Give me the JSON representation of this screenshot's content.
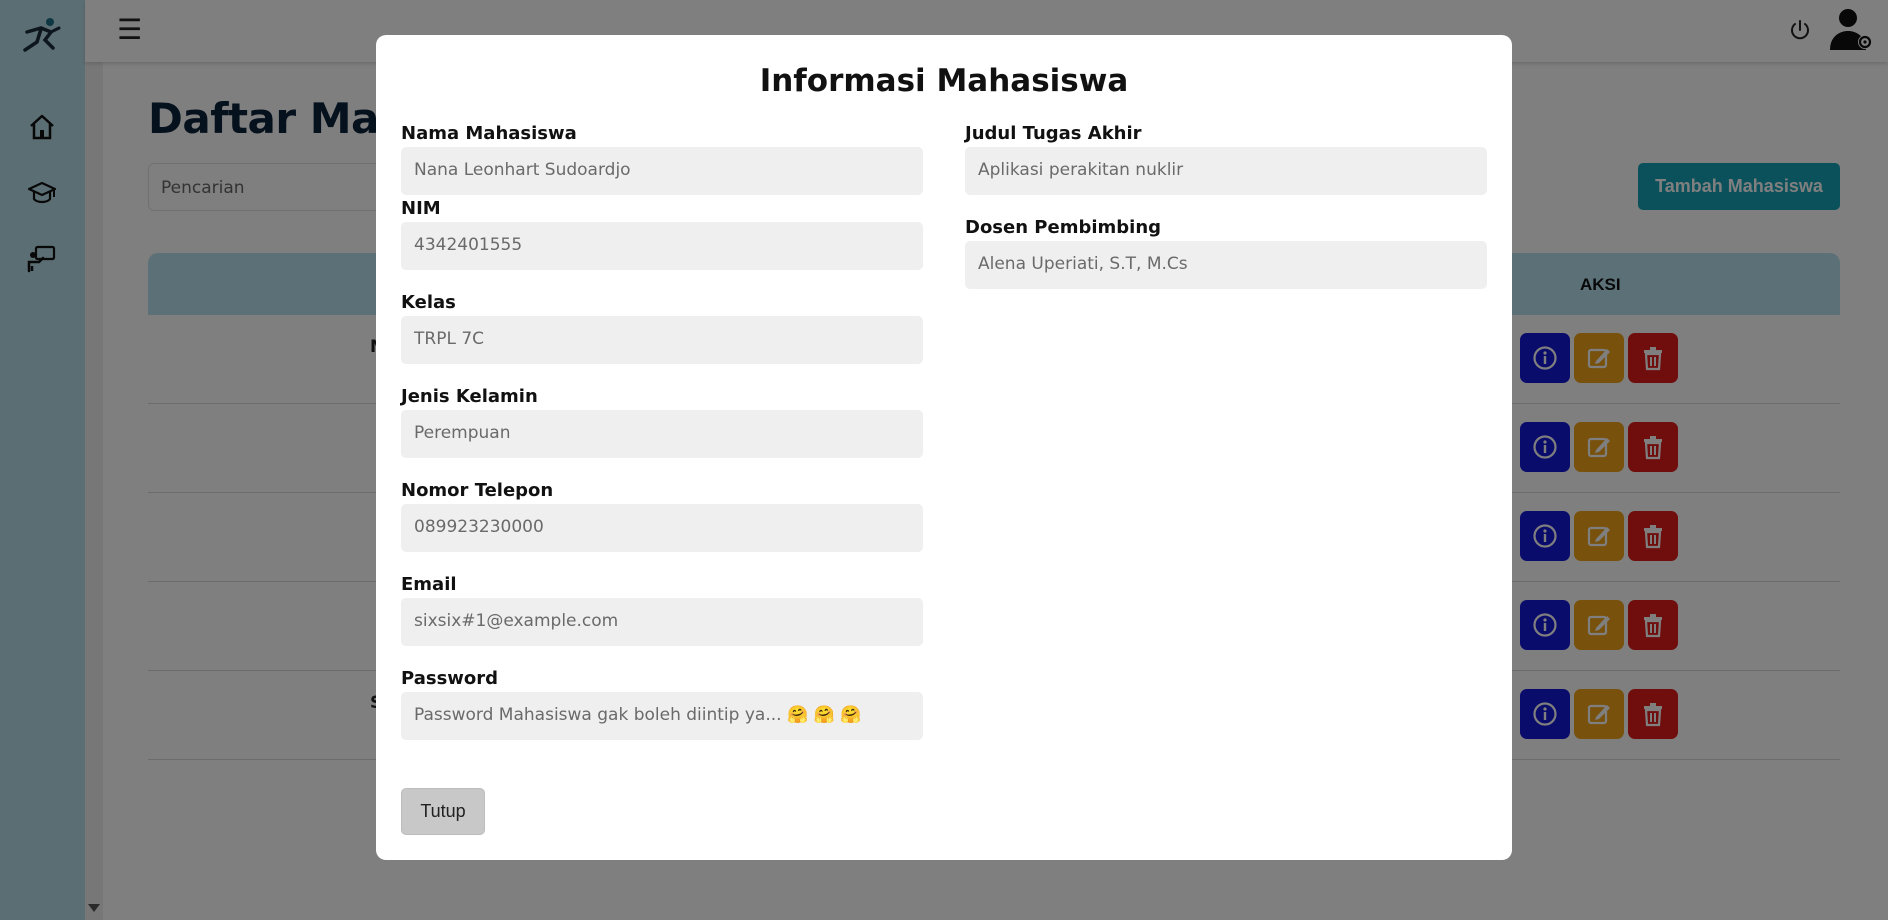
{
  "app": {
    "page_title": "Daftar Maha",
    "search_placeholder": "Pencarian",
    "add_button_label": "Tambah Mahasiswa",
    "table": {
      "action_header": "AKSI",
      "row_fragments": [
        "N",
        "",
        "",
        "",
        "S"
      ]
    }
  },
  "modal": {
    "title": "Informasi Mahasiswa",
    "fields_left": [
      {
        "label": "Nama Mahasiswa",
        "value": "Nana Leonhart Sudoardjo"
      },
      {
        "label": "NIM",
        "value": "4342401555"
      },
      {
        "label": "Kelas",
        "value": "TRPL 7C"
      },
      {
        "label": "Jenis Kelamin",
        "value": "Perempuan"
      },
      {
        "label": "Nomor Telepon",
        "value": "089923230000"
      },
      {
        "label": "Email",
        "value": "sixsix#1@example.com"
      },
      {
        "label": "Password",
        "value": "Password Mahasiswa gak boleh diintip ya... 🤗 🤗 🤗"
      }
    ],
    "fields_right": [
      {
        "label": "Judul Tugas Akhir",
        "value": "Aplikasi perakitan nuklir"
      },
      {
        "label": "Dosen Pembimbing",
        "value": "Alena Uperiati, S.T, M.Cs"
      }
    ],
    "close_label": "Tutup"
  },
  "icons": {
    "logo": "runner-logo-icon",
    "nav": [
      "home-icon",
      "graduation-cap-icon",
      "presentation-icon"
    ],
    "topbar": [
      "menu-icon",
      "power-icon",
      "user-settings-icon"
    ],
    "actions": [
      "info-icon",
      "edit-icon",
      "trash-icon"
    ]
  },
  "colors": {
    "sidebar": "#b7dde6",
    "accent": "#17a2b8",
    "table_header": "#b7e3ef",
    "info": "#1518d6",
    "edit": "#f0a318",
    "delete": "#e01b1b"
  }
}
